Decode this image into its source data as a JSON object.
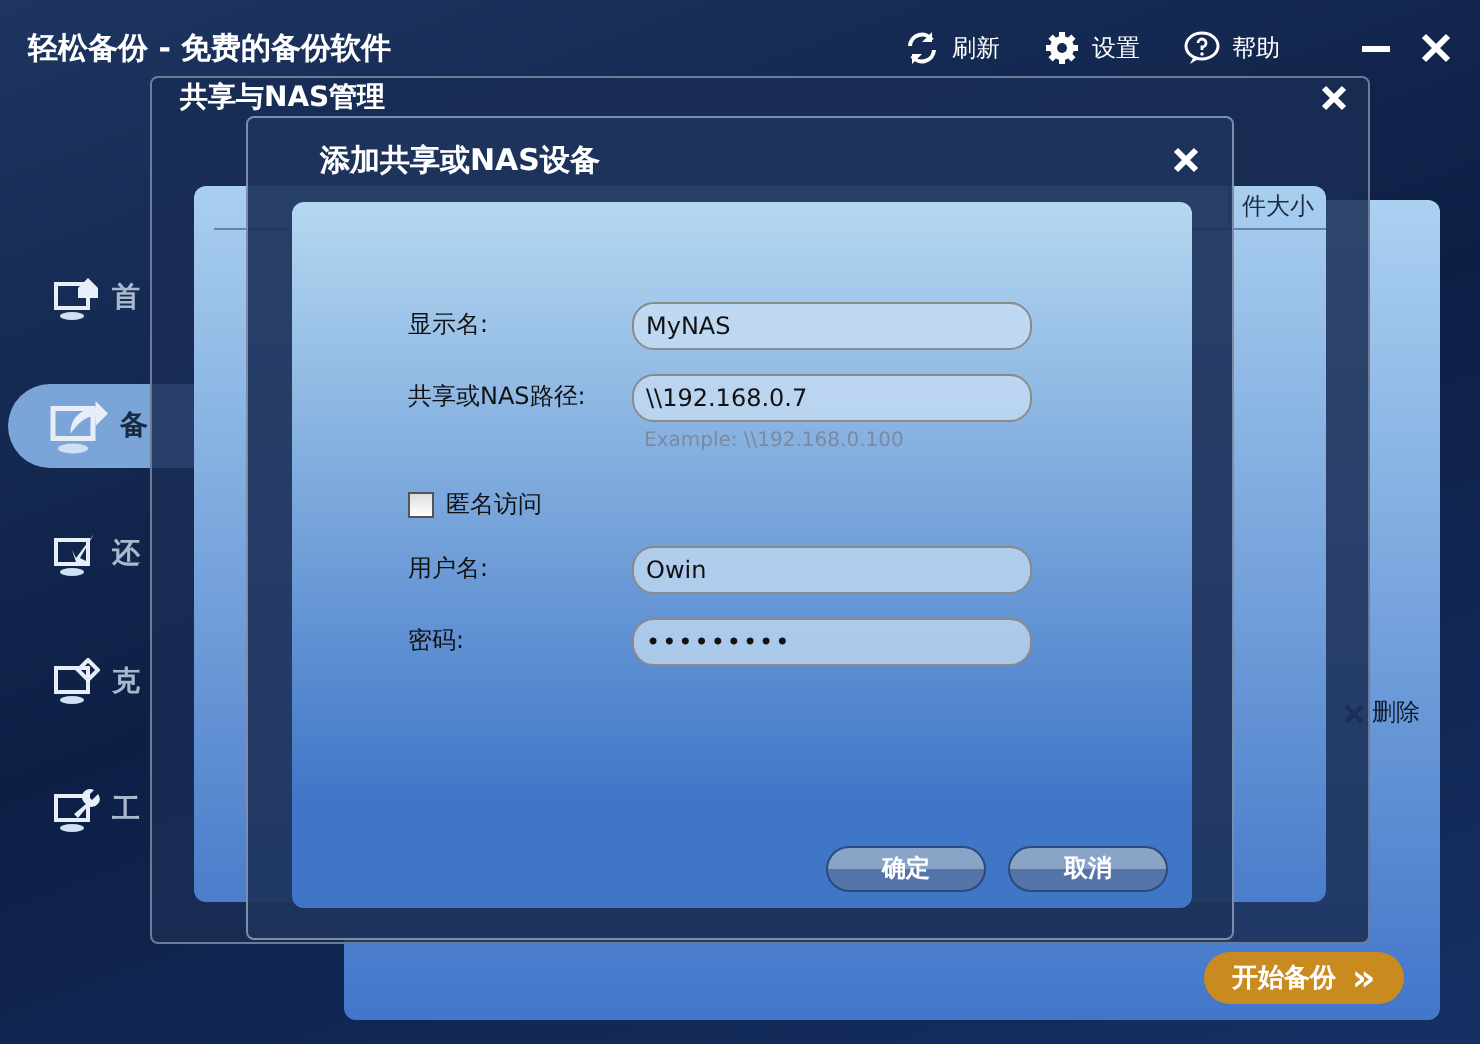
{
  "window": {
    "title": "轻松备份 - 免费的备份软件",
    "toolbar": [
      {
        "kind": "refresh",
        "label": "刷新"
      },
      {
        "kind": "settings",
        "label": "设置"
      },
      {
        "kind": "help",
        "label": "帮助"
      }
    ]
  },
  "sidebar": {
    "items": [
      {
        "kind": "home",
        "label": "首",
        "selected": false
      },
      {
        "kind": "backup",
        "label": "备",
        "selected": true
      },
      {
        "kind": "restore",
        "label": "还",
        "selected": false
      },
      {
        "kind": "clone",
        "label": "克",
        "selected": false
      },
      {
        "kind": "tools",
        "label": "工",
        "selected": false
      }
    ]
  },
  "main_panel": {
    "delete_label": "删除",
    "start_button": "开始备份",
    "start_icon": "»"
  },
  "nas_manager": {
    "title": "共享与NAS管理",
    "table": {
      "columns": [
        "件大小"
      ]
    }
  },
  "add_dialog": {
    "title": "添加共享或NAS设备",
    "fields": [
      {
        "kind": "text",
        "label": "显示名:",
        "value": "MyNAS"
      },
      {
        "kind": "text",
        "label": "共享或NAS路径:",
        "value": "\\\\192.168.0.7",
        "hint": "Example: \\\\192.168.0.100"
      },
      {
        "kind": "checkbox",
        "label": "匿名访问",
        "checked": false
      },
      {
        "kind": "text",
        "label": "用户名:",
        "value": "Owin"
      },
      {
        "kind": "password",
        "label": "密码:",
        "value": "•••••••••"
      }
    ],
    "buttons": [
      "确定",
      "取消"
    ]
  }
}
